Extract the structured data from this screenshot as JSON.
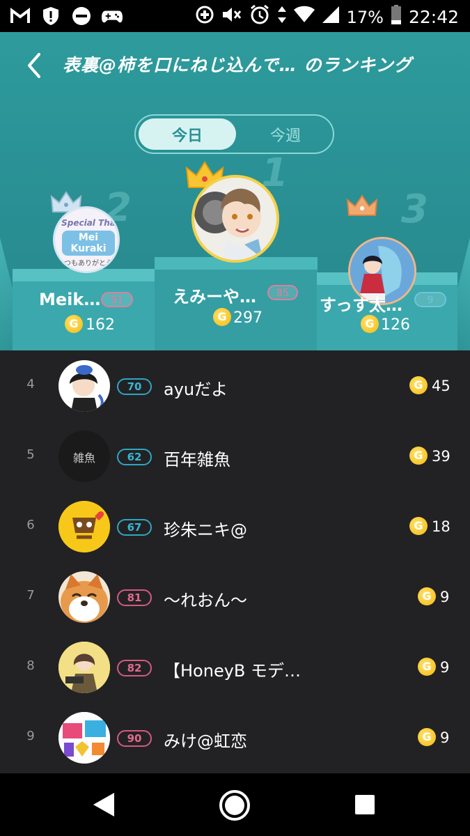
{
  "status_bar": {
    "battery": "17%",
    "time": "22:42"
  },
  "header": {
    "title": "表裏@柿を口にねじ込んで… のランキング",
    "tabs": {
      "today": "今日",
      "week": "今週"
    }
  },
  "podium": [
    {
      "rank": "2",
      "name": "Meik…",
      "level": "91",
      "score": "162",
      "avatar_text": "Special Tha",
      "avatar_sub": "Mei Kuraki",
      "avatar_note": "つもありがとう"
    },
    {
      "rank": "1",
      "name": "えみーや…",
      "level": "85",
      "score": "297"
    },
    {
      "rank": "3",
      "name": "すっす太…",
      "level": "9",
      "score": "126"
    }
  ],
  "ranking": [
    {
      "rank": "4",
      "level": "70",
      "name": "ayuだよ",
      "score": "45"
    },
    {
      "rank": "5",
      "level": "62",
      "name": "百年雑魚",
      "score": "39",
      "avatar_text": "雑魚"
    },
    {
      "rank": "6",
      "level": "67",
      "name": "珍朱ニキ@",
      "score": "18"
    },
    {
      "rank": "7",
      "level": "81",
      "name": "〜れおん〜",
      "score": "9"
    },
    {
      "rank": "8",
      "level": "82",
      "name": "【HoneyB モデ…",
      "score": "9"
    },
    {
      "rank": "9",
      "level": "90",
      "name": "みけ@虹恋",
      "score": "9"
    }
  ],
  "coin_symbol": "G"
}
